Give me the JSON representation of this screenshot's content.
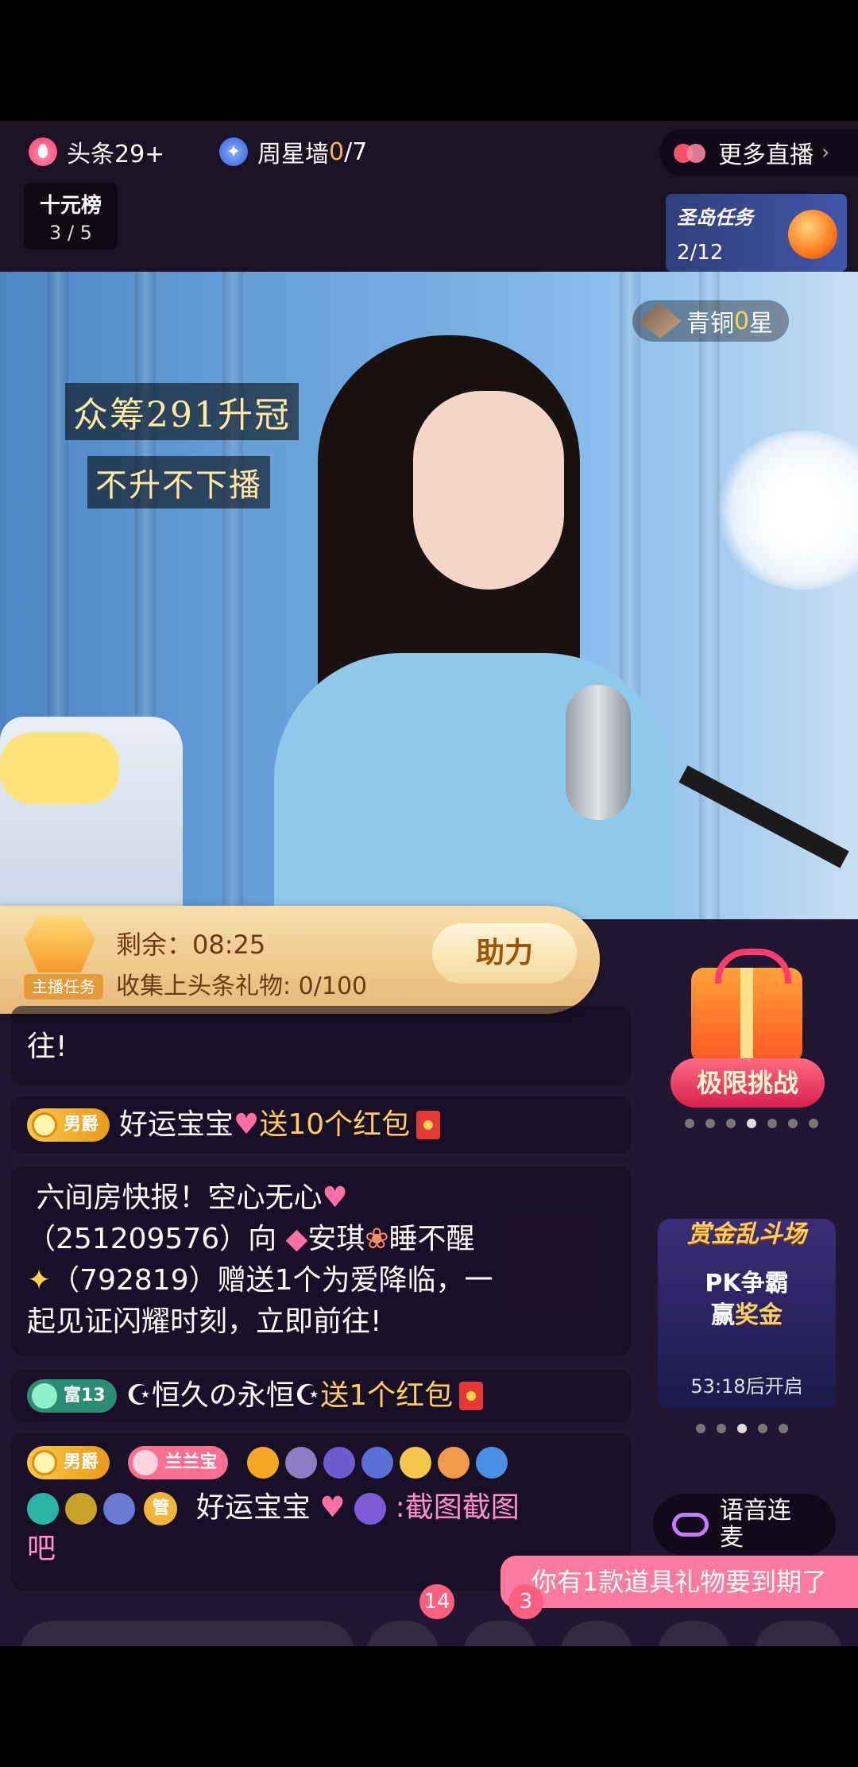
{
  "topbar": {
    "headline_label": "头条29+",
    "star_wall_label": "周星墙",
    "star_wall_current": "0",
    "star_wall_total": "/7",
    "more_live_label": "更多直播",
    "ranking_title": "十元榜",
    "ranking_value": "3 / 5",
    "island_task_title": "圣岛任务",
    "island_task_progress": "2/12"
  },
  "video": {
    "overlay_line1": "众筹291升冠",
    "overlay_line2": "不升不下播",
    "level_prefix": "青铜",
    "level_value": "0",
    "level_suffix": "星"
  },
  "host_task": {
    "badge_label": "主播任务",
    "remaining_label": "剩余：",
    "remaining_time": "08:25",
    "collect_label": "收集上头条礼物:",
    "collect_progress": "0/100",
    "help_button": "助力"
  },
  "chat": {
    "m0_tail": "往!",
    "m1_tag": "男爵",
    "m1_user": "好运宝宝",
    "m1_action": "送10个红包",
    "m2_text": "六间房快报！空心无心",
    "m2_line2": "（251209576）向",
    "m2_target": "安琪",
    "m2_target2": "睡不醒",
    "m2_line3": "（792819）赠送1个为爱降临，一",
    "m2_line4": "起见证闪耀时刻，立即前往!",
    "m3_tag": "富13",
    "m3_user": "☪恒久の永恒☪",
    "m3_action": "送1个红包",
    "m4_tag": "男爵",
    "m4_tag2": "兰兰宝",
    "m4_mgr": "管",
    "m4_user": "好运宝宝",
    "m4_text": ":截图截图",
    "m4_text2": "吧"
  },
  "side": {
    "challenge_label": "极限挑战",
    "arena_title": "赏金乱斗场",
    "arena_pk": "PK争霸",
    "arena_prize_pre": "赢",
    "arena_prize": "奖金",
    "arena_time": "53:18后开启",
    "voice_label_1": "语音连",
    "voice_label_2": "麦"
  },
  "tooltip": "你有1款道具礼物要到期了",
  "bottom": {
    "badge_a": "14",
    "badge_b": "3"
  },
  "colors": {
    "background": "#221732",
    "accent_gold": "#ffcf5c",
    "tooltip_pink": "#ff7aa0"
  }
}
